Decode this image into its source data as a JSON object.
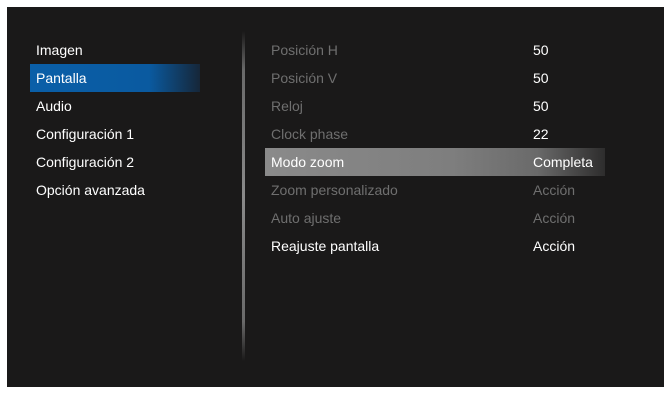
{
  "menu": {
    "items": [
      {
        "label": "Imagen"
      },
      {
        "label": "Pantalla"
      },
      {
        "label": "Audio"
      },
      {
        "label": "Configuración 1"
      },
      {
        "label": "Configuración 2"
      },
      {
        "label": "Opción avanzada"
      }
    ],
    "selected": "Pantalla"
  },
  "settings": {
    "rows": [
      {
        "label": "Posición H",
        "value": "50"
      },
      {
        "label": "Posición V",
        "value": "50"
      },
      {
        "label": "Reloj",
        "value": "50"
      },
      {
        "label": "Clock phase",
        "value": "22"
      },
      {
        "label": "Modo zoom",
        "value": "Completa"
      },
      {
        "label": "Zoom personalizado",
        "value": "Acción"
      },
      {
        "label": "Auto ajuste",
        "value": "Acción"
      },
      {
        "label": "Reajuste pantalla",
        "value": "Acción"
      }
    ],
    "highlighted": "Modo zoom"
  },
  "colors": {
    "background": "#1a1919",
    "selected_menu": "#0a5fa8",
    "highlight_row": "#8a8a8a",
    "dim_text": "#6f6f6f",
    "text": "#ffffff"
  }
}
